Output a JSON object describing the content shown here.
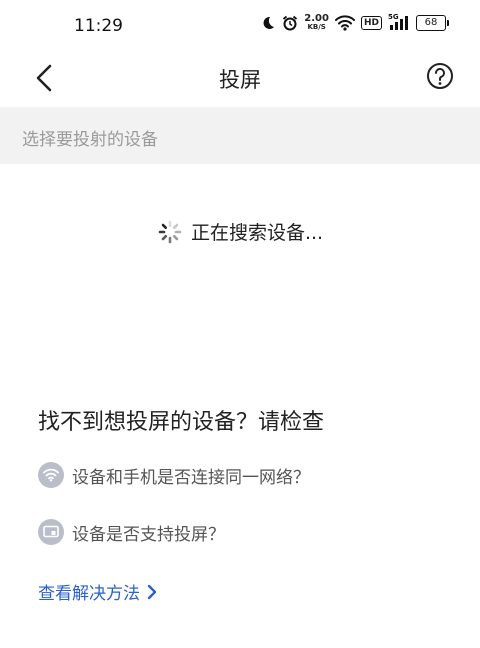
{
  "status_bar": {
    "time": "11:29",
    "net_speed_value": "2.00",
    "net_speed_unit": "KB/S",
    "hd_label": "HD",
    "signal_label": "5G",
    "battery_level": "68"
  },
  "header": {
    "title": "投屏"
  },
  "section": {
    "label": "选择要投射的设备"
  },
  "search": {
    "status_text": "正在搜索设备..."
  },
  "help": {
    "title": "找不到想投屏的设备？请检查",
    "items": [
      {
        "text": "设备和手机是否连接同一网络？",
        "icon": "wifi-icon"
      },
      {
        "text": "设备是否支持投屏？",
        "icon": "cast-icon"
      }
    ],
    "solution_link": "查看解决方法"
  },
  "colors": {
    "accent": "#2a62c9",
    "section_bg": "#f2f2f2",
    "icon_bg": "#b9bec8"
  }
}
